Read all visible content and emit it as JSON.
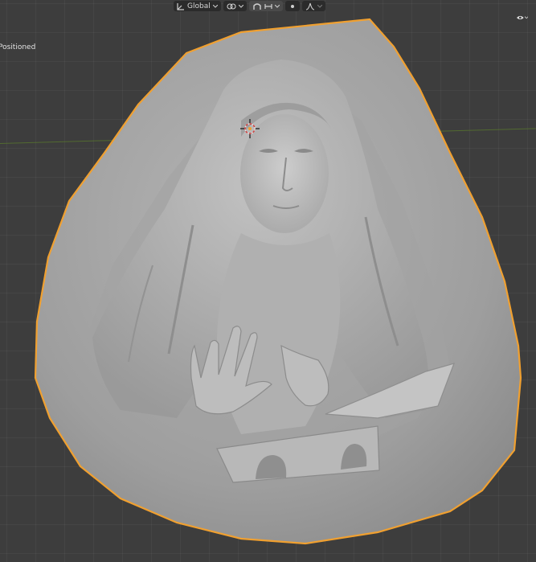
{
  "header": {
    "transform_orientation_label": "Global",
    "icons": [
      "transform-orientation-icon",
      "pivot-icon",
      "snap-icon",
      "snap-target-icon",
      "proportional-edit-icon",
      "falloff-icon"
    ]
  },
  "status": {
    "operator_text": "Positioned"
  },
  "overlay": {
    "icon": "eye-icon"
  },
  "colors": {
    "background": "#3d3d3d",
    "grid": "#464646",
    "selection_outline": "#f0a030",
    "mesh": "#9a9a9a",
    "x_axis": "#5a7a2c"
  }
}
